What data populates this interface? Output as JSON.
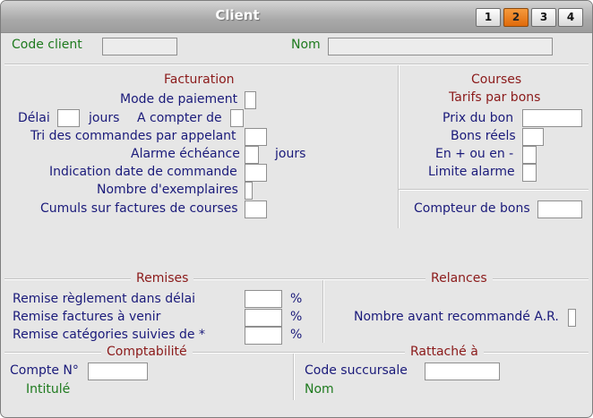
{
  "window": {
    "title": "Client"
  },
  "tabs": [
    {
      "label": "1",
      "active": false
    },
    {
      "label": "2",
      "active": true
    },
    {
      "label": "3",
      "active": false
    },
    {
      "label": "4",
      "active": false
    }
  ],
  "header": {
    "code_client": "Code client",
    "nom": "Nom"
  },
  "facturation": {
    "title": "Facturation",
    "mode_paiement": "Mode de paiement",
    "delai": "Délai",
    "jours": "jours",
    "a_compter_de": "A compter de",
    "tri_commandes": "Tri des commandes par appelant",
    "alarme_echeance": "Alarme échéance",
    "jours2": "jours",
    "indication_date": "Indication date de commande",
    "nombre_exemplaires": "Nombre d'exemplaires",
    "cumuls_factures": "Cumuls sur factures de courses"
  },
  "courses": {
    "title": "Courses",
    "subtitle": "Tarifs par bons",
    "prix_bon": "Prix du bon",
    "bons_reels": "Bons réels",
    "en_plus_moins": "En + ou en -",
    "limite_alarme": "Limite alarme",
    "compteur_bons": "Compteur de bons"
  },
  "remises": {
    "title": "Remises",
    "reglement_delai": "Remise règlement dans délai",
    "factures_venir": "Remise factures à venir",
    "categories_suivies": "Remise catégories suivies de *",
    "pct": "%"
  },
  "relances": {
    "title": "Relances",
    "nombre_avant": "Nombre avant recommandé A.R."
  },
  "comptabilite": {
    "title": "Comptabilité",
    "compte_no": "Compte N°",
    "intitule": "Intitulé"
  },
  "rattache": {
    "title": "Rattaché à",
    "code_succursale": "Code succursale",
    "nom": "Nom"
  }
}
